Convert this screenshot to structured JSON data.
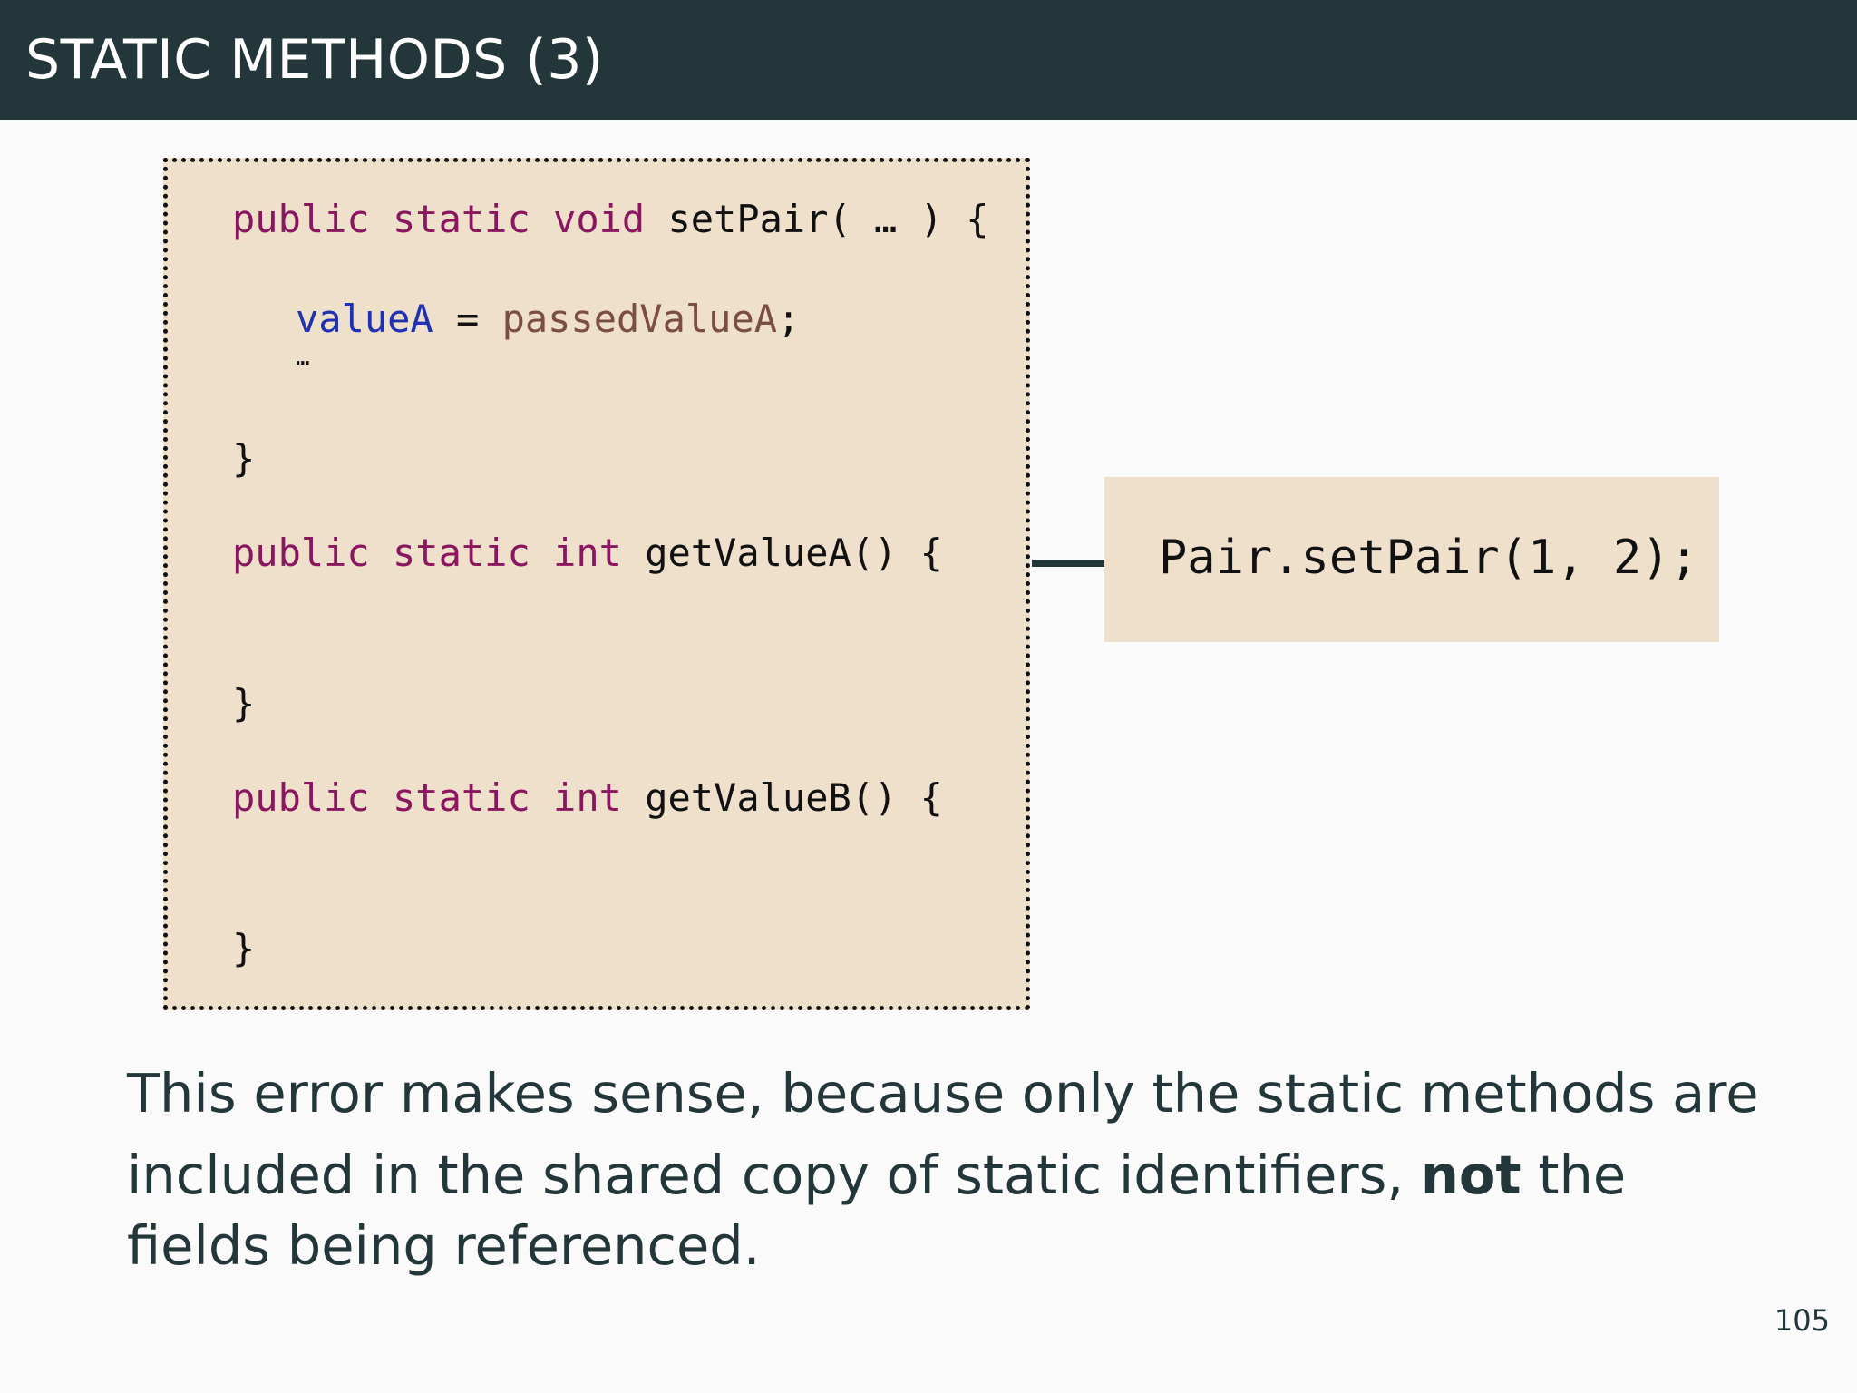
{
  "slide": {
    "title": "STATIC METHODS (3)",
    "page_number": "105"
  },
  "code": {
    "line1": {
      "kw1": "public",
      "kw2": "static",
      "kw3": "void",
      "rest": "setPair( … ) {"
    },
    "line2": {
      "var": "valueA",
      "op": " = ",
      "param": "passedValueA",
      "end": ";"
    },
    "line3": "…",
    "line4": "}",
    "line5": {
      "kw1": "public",
      "kw2": "static",
      "kw3": "int",
      "rest": "getValueA() {"
    },
    "line6": "}",
    "line7": {
      "kw1": "public",
      "kw2": "static",
      "kw3": "int",
      "rest": "getValueB() {"
    },
    "line8": "}"
  },
  "call": {
    "text": "Pair.setPair(1, 2);"
  },
  "explanation": {
    "line1": "This error makes sense, because only the static methods are",
    "line2_start": "included in the shared copy of static identifiers, ",
    "line2_bold": "not",
    "line2_end": " the",
    "line3": "fields being referenced."
  },
  "colors": {
    "title_bar": "#23373b",
    "code_background": "#efe0cb",
    "keyword": "#8b1660",
    "variable": "#1f31b0",
    "parameter": "#7a4e40"
  }
}
